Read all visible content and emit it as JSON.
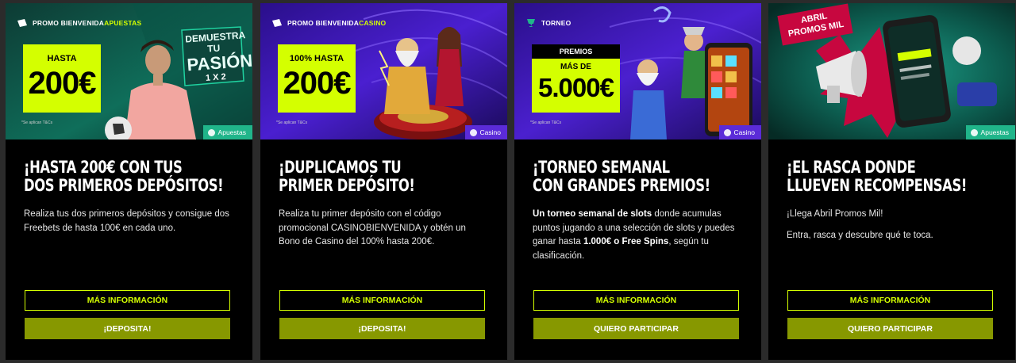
{
  "cards": [
    {
      "promo_prefix": "PROMO BIENVENIDA ",
      "promo_highlight": "APUESTAS",
      "highlight_top": "HASTA",
      "highlight_amount": "200€",
      "slogan_line1": "DEMUESTRA TU",
      "slogan_line2": "PASIÓN",
      "slogan_line3": "1 X 2",
      "tcs": "*Se aplican T&Cs",
      "category": "Apuestas",
      "title_line1": "¡HASTA 200€ CON TUS",
      "title_line2": "DOS PRIMEROS DEPÓSITOS!",
      "description": "Realiza tus dos primeros depósitos y consigue dos Freebets de hasta 100€ en cada uno.",
      "info_button": "MÁS INFORMACIÓN",
      "action_button": "¡DEPOSITA!"
    },
    {
      "promo_prefix": "PROMO BIENVENIDA ",
      "promo_highlight": "CASINO",
      "highlight_top": "100% HASTA",
      "highlight_amount": "200€",
      "tcs": "*Se aplican T&Cs",
      "category": "Casino",
      "title_line1": "¡DUPLICAMOS TU",
      "title_line2": "PRIMER DEPÓSITO!",
      "description": "Realiza tu primer depósito con el código promocional CASINOBIENVENIDA y obtén un Bono de Casino del 100% hasta 200€.",
      "info_button": "MÁS INFORMACIÓN",
      "action_button": "¡DEPOSITA!"
    },
    {
      "promo_label": "TORNEO",
      "prizes_label": "PREMIOS",
      "highlight_top": "MÁS DE",
      "highlight_amount": "5.000€",
      "tcs": "*Se aplican T&Cs",
      "category": "Casino",
      "title_line1": "¡TORNEO SEMANAL",
      "title_line2": "CON GRANDES PREMIOS!",
      "desc_bold1": "Un torneo semanal de slots",
      "desc_text1": " donde acumulas puntos jugando a una selección de slots y puedes ganar hasta ",
      "desc_bold2": "1.000€ o Free Spins",
      "desc_text2": ", según tu clasificación.",
      "info_button": "MÁS INFORMACIÓN",
      "action_button": "QUIERO PARTICIPAR"
    },
    {
      "sticker_line1": "ABRIL",
      "sticker_line2": "PROMOS MIL",
      "category": "Apuestas",
      "title_line1": "¡EL RASCA DONDE",
      "title_line2": "LLUEVEN RECOMPENSAS!",
      "desc_p1": "¡Llega Abril Promos Mil!",
      "desc_p2": "Entra, rasca y descubre qué te toca.",
      "info_button": "MÁS INFORMACIÓN",
      "action_button": "QUIERO PARTICIPAR"
    }
  ],
  "colors": {
    "accent": "#d4ff00",
    "solid_button": "#879800",
    "apuestas": "#20b58a",
    "casino": "#5b2bd8"
  }
}
